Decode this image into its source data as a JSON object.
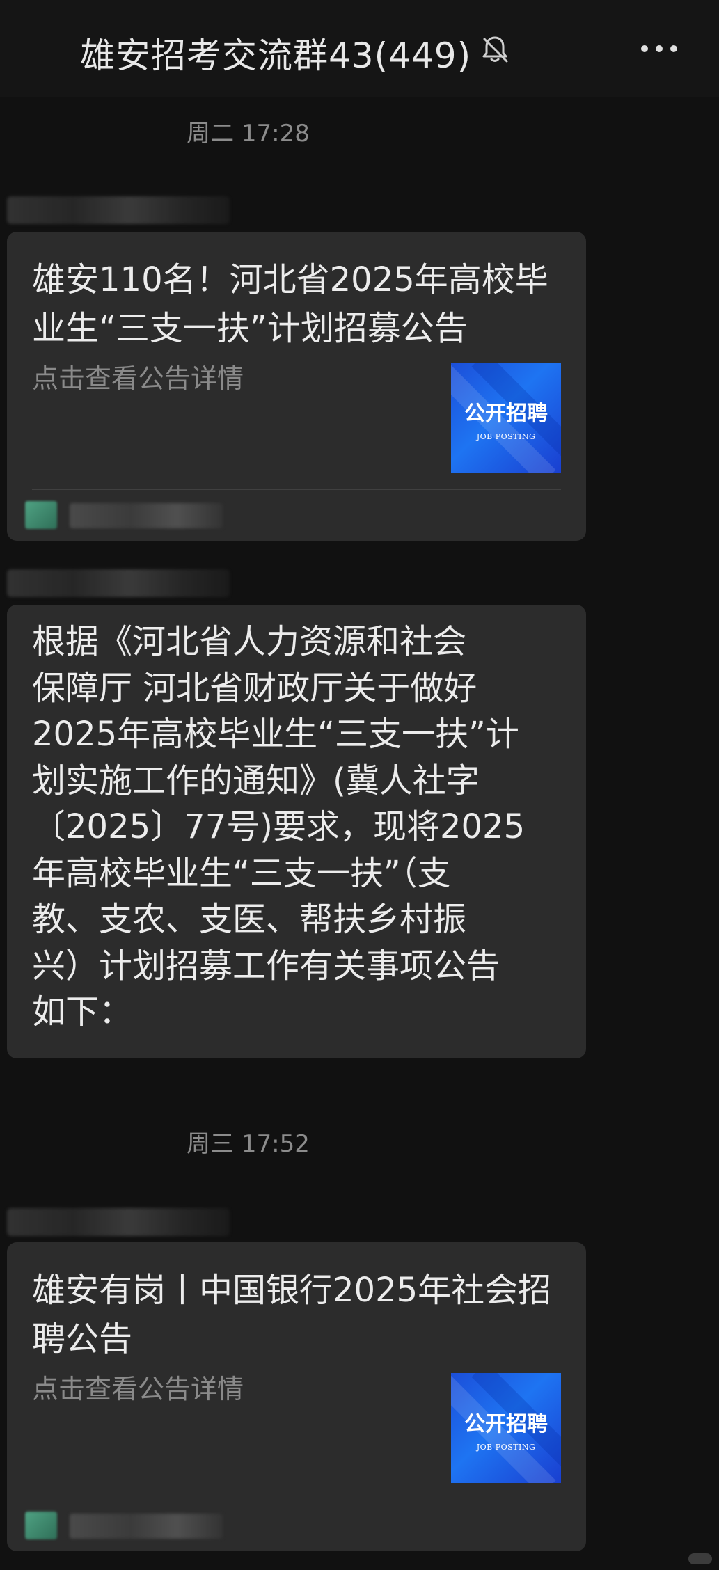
{
  "header": {
    "title": "雄安招考交流群43(449)"
  },
  "messages": [
    {
      "timestamp": "周二 17:28"
    },
    {
      "card": {
        "title": "雄安110名！河北省2025年高校毕业生“三支一扶”计划招募公告",
        "subtitle": "点击查看公告详情",
        "thumb_title": "公开招聘",
        "thumb_sub": "JOB POSTING"
      }
    },
    {
      "text_lines": [
        "根据《河北省人力资源和社会",
        "保障厅 河北省财政厅关于做好",
        "2025年高校毕业生“三支一扶”计",
        "划实施工作的通知》(冀人社字",
        "〔2025〕77号)要求，现将2025",
        "年高校毕业生“三支一扶”（支",
        "教、支农、支医、帮扶乡村振",
        "兴）计划招募工作有关事项公告",
        "如下："
      ]
    },
    {
      "timestamp": "周三 17:52"
    },
    {
      "card": {
        "title": "雄安有岗丨中国银行2025年社会招聘公告",
        "subtitle": "点击查看公告详情",
        "thumb_title": "公开招聘",
        "thumb_sub": "JOB POSTING"
      }
    }
  ],
  "icons": {
    "mute": "bell-off-icon",
    "more": "more-dots-icon"
  },
  "colors": {
    "background": "#111111",
    "bubble": "#2c2c2c",
    "thumb_blue": "#1e74f2"
  }
}
